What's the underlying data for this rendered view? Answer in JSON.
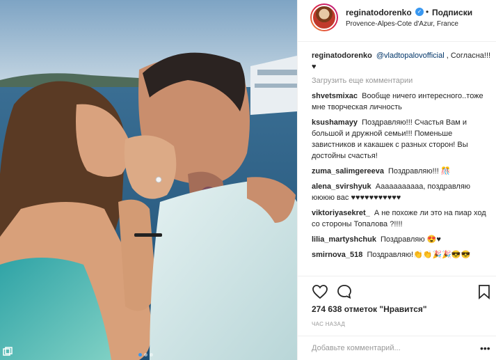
{
  "header": {
    "username": "reginatodorenko",
    "separator": "•",
    "follow_label": "Подписки",
    "location": "Provence-Alpes-Cote d'Azur, France"
  },
  "caption": {
    "username": "reginatodorenko",
    "mention": "@vladtopalovofficial",
    "text": " , Согласна!!! ♥"
  },
  "load_more_label": "Загрузить еще комментарии",
  "comments": [
    {
      "username": "shvetsmixac",
      "text": "Вообще ничего интересного..тоже мне творческая личность"
    },
    {
      "username": "ksushamayy",
      "text": "Поздравляю!!! Счастья Вам и большой и дружной семьи!!! Поменьше завистников и какашек с разных сторон! Вы достойны счастья!"
    },
    {
      "username": "zuma_salimgereeva",
      "text": "Поздравляю!!! 🎊"
    },
    {
      "username": "alena_svirshyuk",
      "text": "Ааааааааааа, поздравляю юююю вас ♥♥♥♥♥♥♥♥♥♥♥"
    },
    {
      "username": "viktoriyasekret_",
      "text": "А не похоже ли это на пиар ход со стороны Топалова ?!!!!"
    },
    {
      "username": "lilia_martyshchuk",
      "text": "Поздравляю 😍♥"
    },
    {
      "username": "smirnova_518",
      "text": "Поздравляю!👏👏🎉🎉😎😎"
    }
  ],
  "likes_text": "274 638 отметок \"Нравится\"",
  "time_text": "ЧАС НАЗАД",
  "add_comment_placeholder": "Добавьте комментарий...",
  "more_label": "•••",
  "icons": {
    "like": "heart-outline-icon",
    "comment": "speech-bubble-icon",
    "save": "bookmark-icon",
    "gallery": "multiple-photos-icon",
    "verified": "verified-badge-icon"
  },
  "colors": {
    "verified": "#3897f0",
    "link": "#003569",
    "muted": "#999999",
    "text": "#262626",
    "border": "#efefef"
  }
}
